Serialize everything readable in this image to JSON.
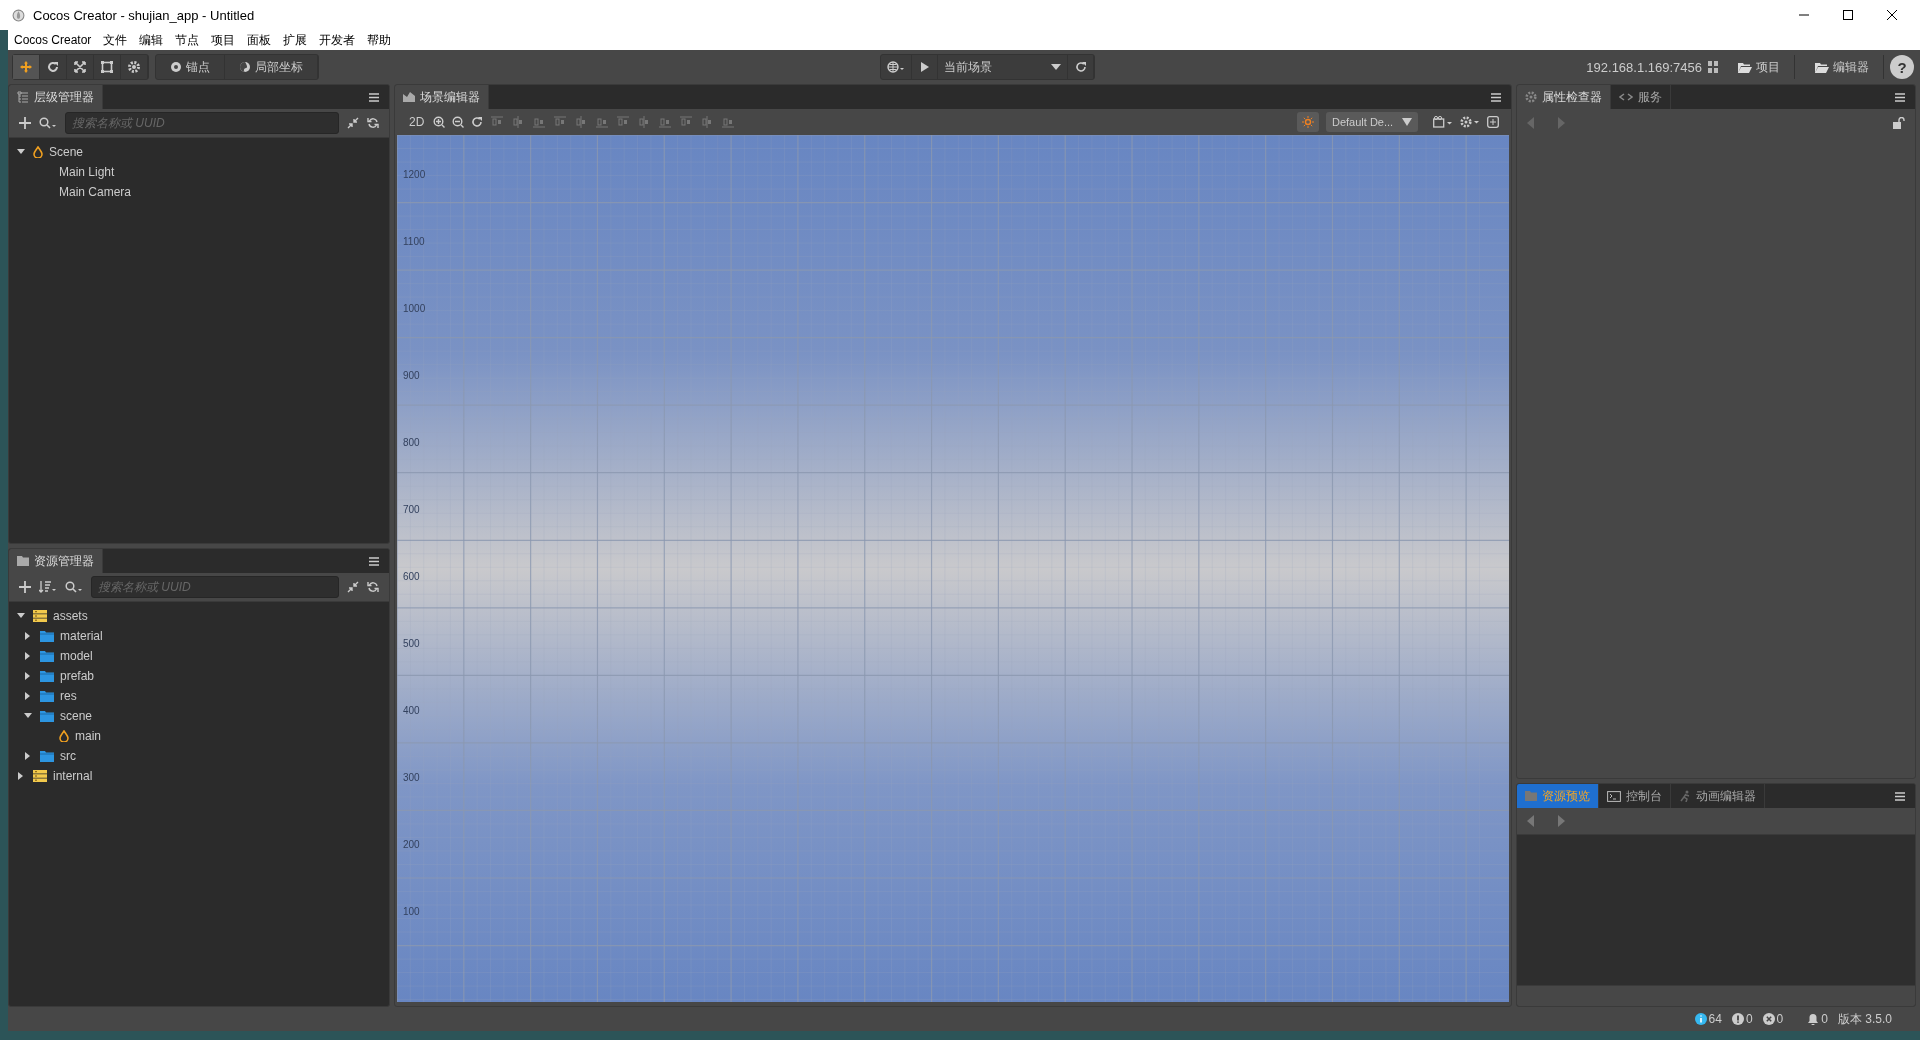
{
  "window": {
    "title": "Cocos Creator - shujian_app - Untitled"
  },
  "menu": [
    "Cocos Creator",
    "文件",
    "编辑",
    "节点",
    "项目",
    "面板",
    "扩展",
    "开发者",
    "帮助"
  ],
  "tools": [
    {
      "kind": "move",
      "selected": true
    },
    {
      "kind": "rotate",
      "selected": false
    },
    {
      "kind": "scale",
      "selected": false
    },
    {
      "kind": "rect",
      "selected": false
    },
    {
      "kind": "transform",
      "selected": false
    }
  ],
  "pivot_buttons": [
    "锚点",
    "局部坐标"
  ],
  "preview": {
    "scene": "当前场景",
    "address": "192.168.1.169:7456"
  },
  "open_buttons": [
    "项目",
    "编辑器"
  ],
  "help": "?",
  "hierarchy": {
    "title": "层级管理器",
    "placeholder": "搜索名称或 UUID",
    "tree": [
      {
        "name": "Scene",
        "kind": "scene",
        "expanded": true,
        "children": [
          {
            "name": "Main Light"
          },
          {
            "name": "Main Camera"
          }
        ]
      }
    ]
  },
  "scene_editor": {
    "title": "场景编辑器",
    "mode": "2D",
    "camera": "Default De...",
    "y_axis": [
      "1200",
      "1100",
      "1000",
      "900",
      "800",
      "700",
      "600",
      "500",
      "400",
      "300",
      "200",
      "100"
    ]
  },
  "assets": {
    "title": "资源管理器",
    "placeholder": "搜索名称或 UUID",
    "tree": [
      {
        "name": "assets",
        "kind": "db",
        "expanded": true,
        "children": [
          {
            "name": "material",
            "kind": "folder",
            "expanded": false
          },
          {
            "name": "model",
            "kind": "folder",
            "expanded": false
          },
          {
            "name": "prefab",
            "kind": "folder",
            "expanded": false
          },
          {
            "name": "res",
            "kind": "folder",
            "expanded": false
          },
          {
            "name": "scene",
            "kind": "folder",
            "expanded": true,
            "children": [
              {
                "name": "main",
                "kind": "scene"
              }
            ]
          },
          {
            "name": "src",
            "kind": "folder",
            "expanded": false
          }
        ]
      },
      {
        "name": "internal",
        "kind": "db",
        "expanded": false
      }
    ]
  },
  "inspector_tabs": [
    {
      "label": "属性检查器",
      "kind": "inspector",
      "selected": true
    },
    {
      "label": "服务",
      "kind": "service",
      "selected": false
    }
  ],
  "bottom_tabs": [
    {
      "label": "资源预览",
      "kind": "preview",
      "selected": true
    },
    {
      "label": "控制台",
      "kind": "console",
      "selected": false
    },
    {
      "label": "动画编辑器",
      "kind": "animation",
      "selected": false
    }
  ],
  "status_bar": {
    "info": "64",
    "warnings": "0",
    "errors": "0",
    "notifications": "0",
    "version": "版本 3.5.0"
  }
}
